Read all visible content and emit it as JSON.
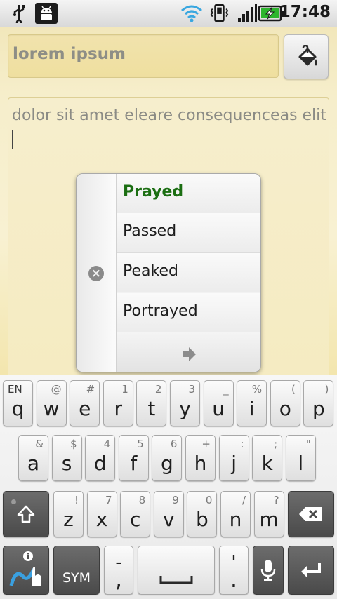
{
  "status_bar": {
    "time": "17:48",
    "icons": [
      "usb-icon",
      "android-debug-icon",
      "wifi-icon",
      "vibrate-icon",
      "signal-icon",
      "battery-charging-icon"
    ],
    "battery_color": "#2db52d"
  },
  "note": {
    "title_placeholder": "lorem ipsum",
    "body_text": "dolor sit amet eleare consequenceas elit",
    "paint_button_icon": "paint-bucket-icon"
  },
  "suggestions": {
    "top": "Prayed",
    "items": [
      "Passed",
      "Peaked",
      "Portrayed"
    ],
    "top_color": "#1b6e12"
  },
  "keyboard": {
    "row1": [
      {
        "key": "q",
        "alt": "EN"
      },
      {
        "key": "w",
        "alt": "@"
      },
      {
        "key": "e",
        "alt": "#"
      },
      {
        "key": "r",
        "alt": "1"
      },
      {
        "key": "t",
        "alt": "2"
      },
      {
        "key": "y",
        "alt": "3"
      },
      {
        "key": "u",
        "alt": "_"
      },
      {
        "key": "i",
        "alt": "%"
      },
      {
        "key": "o",
        "alt": "("
      },
      {
        "key": "p",
        "alt": ")"
      }
    ],
    "row2": [
      {
        "key": "a",
        "alt": "&"
      },
      {
        "key": "s",
        "alt": "$"
      },
      {
        "key": "d",
        "alt": "4"
      },
      {
        "key": "f",
        "alt": "5"
      },
      {
        "key": "g",
        "alt": "6"
      },
      {
        "key": "h",
        "alt": "+"
      },
      {
        "key": "j",
        "alt": ":"
      },
      {
        "key": "k",
        "alt": ";"
      },
      {
        "key": "l",
        "alt": "\""
      }
    ],
    "row3": [
      {
        "key": "z",
        "alt": "!"
      },
      {
        "key": "x",
        "alt": "7"
      },
      {
        "key": "c",
        "alt": "8"
      },
      {
        "key": "v",
        "alt": "9"
      },
      {
        "key": "b",
        "alt": "0"
      },
      {
        "key": "n",
        "alt": "/"
      },
      {
        "key": "m",
        "alt": "?"
      }
    ],
    "sym_label": "SYM",
    "dash_label": "-",
    "comma_label": ",",
    "apostrophe_label": "'",
    "period_label": "."
  }
}
